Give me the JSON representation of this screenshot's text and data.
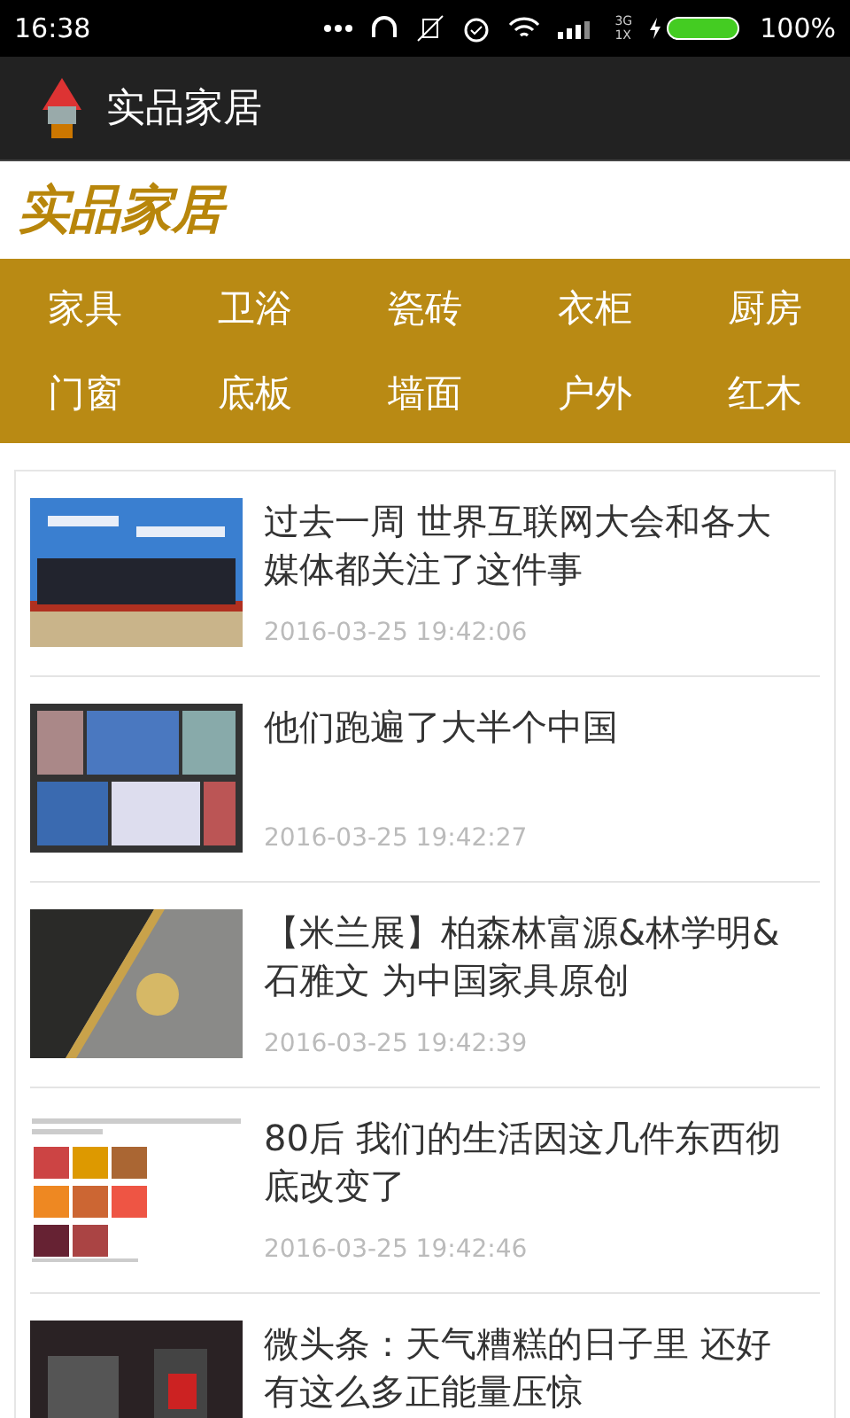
{
  "status_bar": {
    "time": "16:38",
    "network_top": "3G",
    "network_bottom": "1X",
    "battery": "100%"
  },
  "app_bar": {
    "title": "实品家居"
  },
  "brand": {
    "title": "实品家居"
  },
  "categories": [
    {
      "label": "家具"
    },
    {
      "label": "卫浴"
    },
    {
      "label": "瓷砖"
    },
    {
      "label": "衣柜"
    },
    {
      "label": "厨房"
    },
    {
      "label": "门窗"
    },
    {
      "label": "底板"
    },
    {
      "label": "墙面"
    },
    {
      "label": "户外"
    },
    {
      "label": "红木"
    }
  ],
  "articles": [
    {
      "title": "过去一周 世界互联网大会和各大媒体都关注了这件事",
      "time": "2016-03-25 19:42:06"
    },
    {
      "title": "他们跑遍了大半个中国",
      "time": "2016-03-25 19:42:27"
    },
    {
      "title": "【米兰展】柏森林富源&林学明&石雅文 为中国家具原创",
      "time": "2016-03-25 19:42:39"
    },
    {
      "title": "80后 我们的生活因这几件东西彻底改变了",
      "time": "2016-03-25 19:42:46"
    },
    {
      "title": "微头条：天气糟糕的日子里 还好有这么多正能量压惊"
    }
  ]
}
